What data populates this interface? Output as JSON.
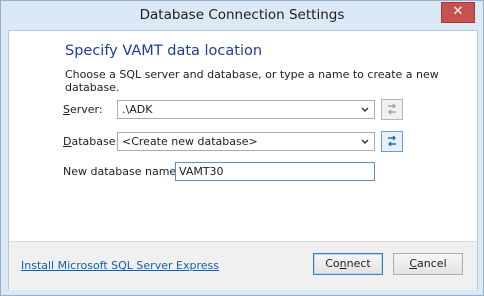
{
  "window": {
    "title": "Database Connection Settings"
  },
  "heading": "Specify VAMT data location",
  "subtitle": "Choose a SQL server and database, or type a name to create a new database.",
  "server": {
    "label_first": "S",
    "label_rest": "erver:",
    "value": ".\\ADK"
  },
  "database": {
    "label_first": "D",
    "label_rest": "atabase:",
    "value": "<Create new database>"
  },
  "new_db": {
    "label": "New database name:",
    "value": "VAMT30"
  },
  "footer": {
    "link": "Install Microsoft SQL Server Express",
    "connect_pre": "Co",
    "connect_u": "n",
    "connect_post": "nect",
    "cancel_u": "C",
    "cancel_post": "ancel"
  }
}
